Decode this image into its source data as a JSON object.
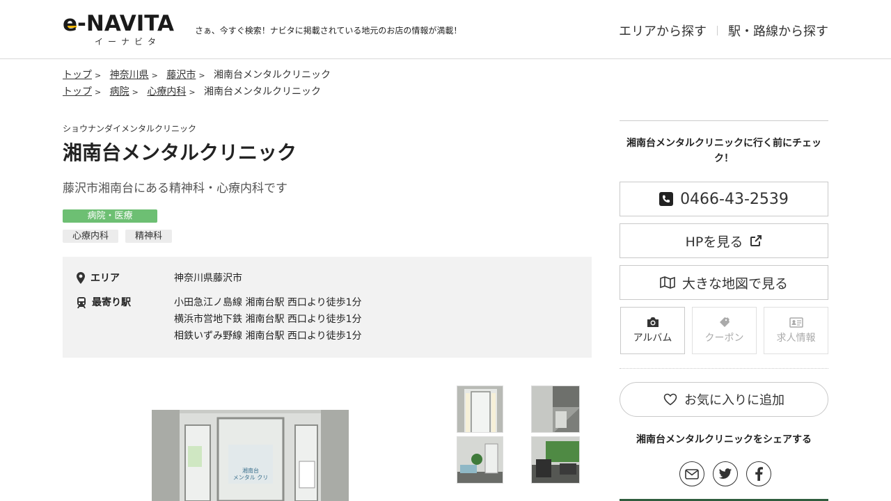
{
  "header": {
    "logo_text": "e-NAVITA",
    "logo_sub": "イーナビタ",
    "tagline": "さぁ、今すぐ検索！ナビタに掲載されている地元のお店の情報が満載！",
    "nav": {
      "area_label": "エリアから探す",
      "station_label": "駅・路線から探す"
    }
  },
  "breadcrumbs": {
    "row1": [
      "トップ",
      "神奈川県",
      "藤沢市",
      "湘南台メンタルクリニック"
    ],
    "row2": [
      "トップ",
      "病院",
      "心療内科",
      "湘南台メンタルクリニック"
    ]
  },
  "shop": {
    "kana": "ショウナンダイメンタルクリニック",
    "name": "湘南台メンタルクリニック",
    "description": "藤沢市湘南台にある精神科・心療内科です",
    "category": "病院・医療",
    "tags": [
      "心療内科",
      "精神科"
    ],
    "area_label": "エリア",
    "area_value": "神奈川県藤沢市",
    "station_label": "最寄り駅",
    "stations": [
      "小田急江ノ島線 湘南台駅 西口より徒歩1分",
      "横浜市営地下鉄 湘南台駅 西口より徒歩1分",
      "相鉄いずみ野線 湘南台駅 西口より徒歩1分"
    ],
    "photo_sign": [
      "湘南台",
      "メンタル クリ"
    ]
  },
  "sidebar": {
    "check_text": "湘南台メンタルクリニックに行く前にチェック！",
    "phone": "0466-43-2539",
    "hp_label": "HPを見る",
    "map_label": "大きな地図で見る",
    "album_label": "アルバム",
    "coupon_label": "クーポン",
    "jobs_label": "求人情報",
    "favorite_label": "お気に入りに追加",
    "share_title": "湘南台メンタルクリニックをシェアする"
  },
  "colors": {
    "category_badge": "#6dbf73",
    "info_box": "#f2f2f2",
    "logo_accent": "#f2b705",
    "footer_accent": "#2f5d3e"
  }
}
